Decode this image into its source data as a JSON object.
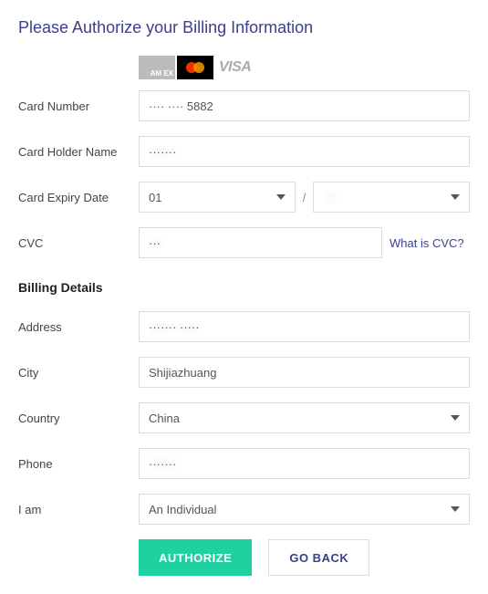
{
  "title": "Please Authorize your Billing Information",
  "card_logos": {
    "amex": "AM\nEX",
    "visa": "VISA"
  },
  "labels": {
    "card_number": "Card Number",
    "card_holder": "Card Holder Name",
    "expiry": "Card Expiry Date",
    "cvc": "CVC",
    "address": "Address",
    "city": "City",
    "country": "Country",
    "phone": "Phone",
    "iam": "I am"
  },
  "values": {
    "card_number": "···· ···· 5882",
    "card_holder": "·······",
    "expiry_month": "01",
    "expiry_year": "····",
    "cvc": "···",
    "address": "······· ·····",
    "city": "Shijiazhuang",
    "country": "China",
    "phone": "·······",
    "iam": "An Individual"
  },
  "links": {
    "cvc_help": "What is CVC?"
  },
  "section": {
    "billing": "Billing Details"
  },
  "buttons": {
    "authorize": "AUTHORIZE",
    "back": "GO BACK"
  }
}
